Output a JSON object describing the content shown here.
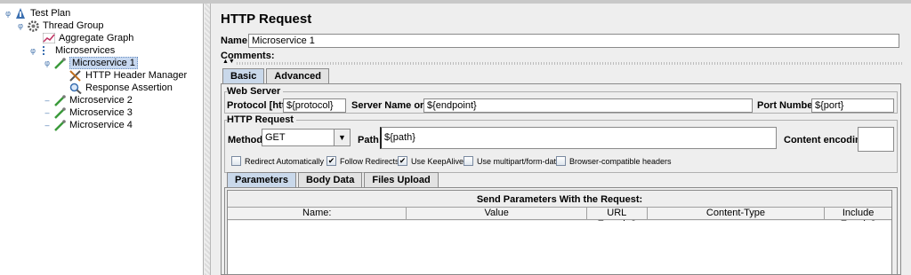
{
  "tree": {
    "nodes": [
      {
        "label": "Test Plan",
        "icon": "test-plan-icon",
        "toggle": "φ"
      },
      {
        "label": "Thread Group",
        "icon": "gear-icon",
        "toggle": "φ"
      },
      {
        "label": "Aggregate Graph",
        "icon": "graph-icon",
        "toggle": ""
      },
      {
        "label": "Microservices",
        "icon": "controller-icon",
        "toggle": "φ"
      },
      {
        "label": "Microservice 1",
        "icon": "pipette-icon",
        "toggle": "φ"
      },
      {
        "label": "HTTP Header Manager",
        "icon": "tools-icon",
        "toggle": ""
      },
      {
        "label": "Response Assertion",
        "icon": "magnifier-icon",
        "toggle": ""
      },
      {
        "label": "Microservice 2",
        "icon": "pipette-icon",
        "toggle": "–"
      },
      {
        "label": "Microservice 3",
        "icon": "pipette-icon",
        "toggle": "–"
      },
      {
        "label": "Microservice 4",
        "icon": "pipette-icon",
        "toggle": "–"
      }
    ]
  },
  "panel": {
    "title": "HTTP Request",
    "name_label": "Name:",
    "name_value": "Microservice 1",
    "comments_label": "Comments:",
    "tabs": [
      "Basic",
      "Advanced"
    ],
    "web_server": {
      "title": "Web Server",
      "protocol_label": "Protocol [http]:",
      "protocol_value": "${protocol}",
      "server_label": "Server Name or IP:",
      "server_value": "${endpoint}",
      "port_label": "Port Number:",
      "port_value": "${port}"
    },
    "http_request": {
      "title": "HTTP Request",
      "method_label": "Method:",
      "method_value": "GET",
      "path_label": "Path:",
      "path_value": "${path}",
      "encoding_label": "Content encoding:",
      "encoding_value": ""
    },
    "checkboxes": [
      {
        "label": "Redirect Automatically",
        "checked": false
      },
      {
        "label": "Follow Redirects",
        "checked": true
      },
      {
        "label": "Use KeepAlive",
        "checked": true
      },
      {
        "label": "Use multipart/form-data",
        "checked": false
      },
      {
        "label": "Browser-compatible headers",
        "checked": false
      }
    ],
    "subtabs": [
      "Parameters",
      "Body Data",
      "Files Upload"
    ],
    "params_table": {
      "caption": "Send Parameters With the Request:",
      "columns": [
        "Name:",
        "Value",
        "URL Encode?",
        "Content-Type",
        "Include Equals?"
      ]
    }
  }
}
